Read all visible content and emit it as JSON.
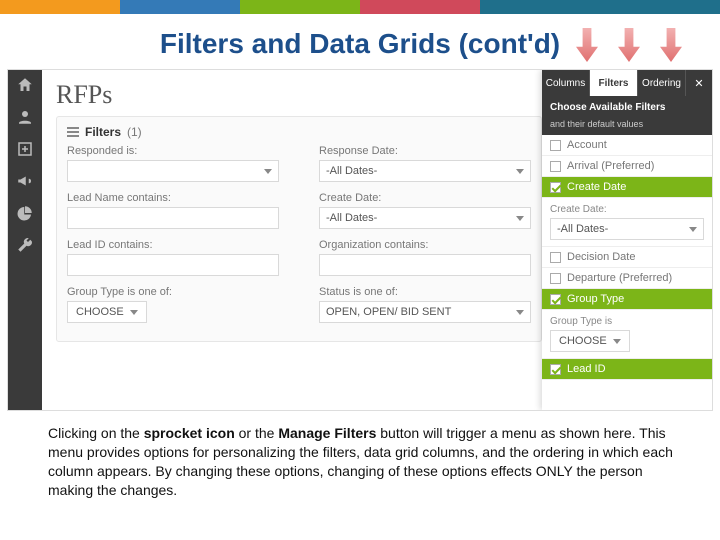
{
  "topbar_colors": [
    "#f39a1e",
    "#347ab7",
    "#7cb518",
    "#d0495b",
    "#1f6f8b",
    "#1f6f8b"
  ],
  "slide_title": "Filters and Data Grids (cont'd)",
  "page_heading": "RFPs",
  "filters": {
    "header_label": "Filters",
    "count": "(1)",
    "rows": [
      {
        "left_label": "Responded is:",
        "left_type": "select",
        "left_value": "",
        "right_label": "Response Date:",
        "right_type": "select",
        "right_value": "-All Dates-"
      },
      {
        "left_label": "Lead Name contains:",
        "left_type": "input",
        "left_value": "",
        "right_label": "Create Date:",
        "right_type": "select",
        "right_value": "-All Dates-"
      },
      {
        "left_label": "Lead ID contains:",
        "left_type": "input",
        "left_value": "",
        "right_label": "Organization contains:",
        "right_type": "input",
        "right_value": ""
      },
      {
        "left_label": "Group Type is one of:",
        "left_type": "choose",
        "left_value": "CHOOSE",
        "right_label": "Status is one of:",
        "right_type": "select",
        "right_value": "OPEN, OPEN/ BID SENT"
      }
    ]
  },
  "drawer": {
    "tabs": [
      "Columns",
      "Filters",
      "Ordering"
    ],
    "active_tab": 1,
    "sub1": "Choose Available Filters",
    "sub2": "and their default values",
    "items": [
      {
        "label": "Account",
        "checked": false
      },
      {
        "label": "Arrival (Preferred)",
        "checked": false
      },
      {
        "label": "Create Date",
        "checked": true,
        "expand_label": "Create Date:",
        "expand_value": "-All Dates-"
      },
      {
        "label": "Decision Date",
        "checked": false
      },
      {
        "label": "Departure (Preferred)",
        "checked": false
      },
      {
        "label": "Group Type",
        "checked": true,
        "expand_label": "Group Type is",
        "expand_value": "CHOOSE"
      },
      {
        "label": "Lead ID",
        "checked": true
      }
    ]
  },
  "caption_parts": {
    "p1": "Clicking on the ",
    "b1": "sprocket icon",
    "p2": "  or the ",
    "b2": "Manage Filters",
    "p3": " button will trigger a menu as shown here.  This menu provides options for personalizing the filters, data grid columns, and the ordering in which each column appears.  By changing these options, changing of these options effects ONLY the person making the changes."
  }
}
